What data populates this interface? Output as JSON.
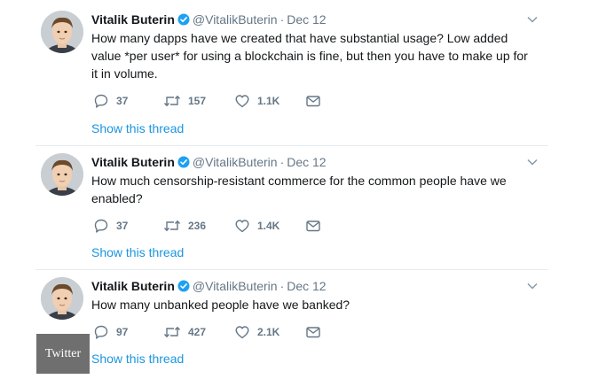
{
  "tweets": [
    {
      "author_name": "Vitalik Buterin",
      "handle": "@VitalikButerin",
      "separator": "·",
      "date": "Dec 12",
      "text": "How many dapps have we created that have substantial usage? Low added value *per user* for using a blockchain is fine, but then you have to make up for it in volume.",
      "replies": "37",
      "retweets": "157",
      "likes": "1.1K",
      "show_thread": "Show this thread"
    },
    {
      "author_name": "Vitalik Buterin",
      "handle": "@VitalikButerin",
      "separator": "·",
      "date": "Dec 12",
      "text": "How much censorship-resistant commerce for the common people have we enabled?",
      "replies": "37",
      "retweets": "236",
      "likes": "1.4K",
      "show_thread": "Show this thread"
    },
    {
      "author_name": "Vitalik Buterin",
      "handle": "@VitalikButerin",
      "separator": "·",
      "date": "Dec 12",
      "text": "How many unbanked people have we banked?",
      "replies": "97",
      "retweets": "427",
      "likes": "2.1K",
      "show_thread": "Show this thread"
    }
  ],
  "watermark": "Twitter",
  "icons": {
    "verified": "verified-badge-icon",
    "caret": "chevron-down-icon",
    "reply": "reply-icon",
    "retweet": "retweet-icon",
    "like": "heart-icon",
    "message": "envelope-icon"
  },
  "colors": {
    "link": "#1b95e0",
    "muted": "#657786",
    "verified": "#1da1f2",
    "divider": "#e6ecf0"
  }
}
